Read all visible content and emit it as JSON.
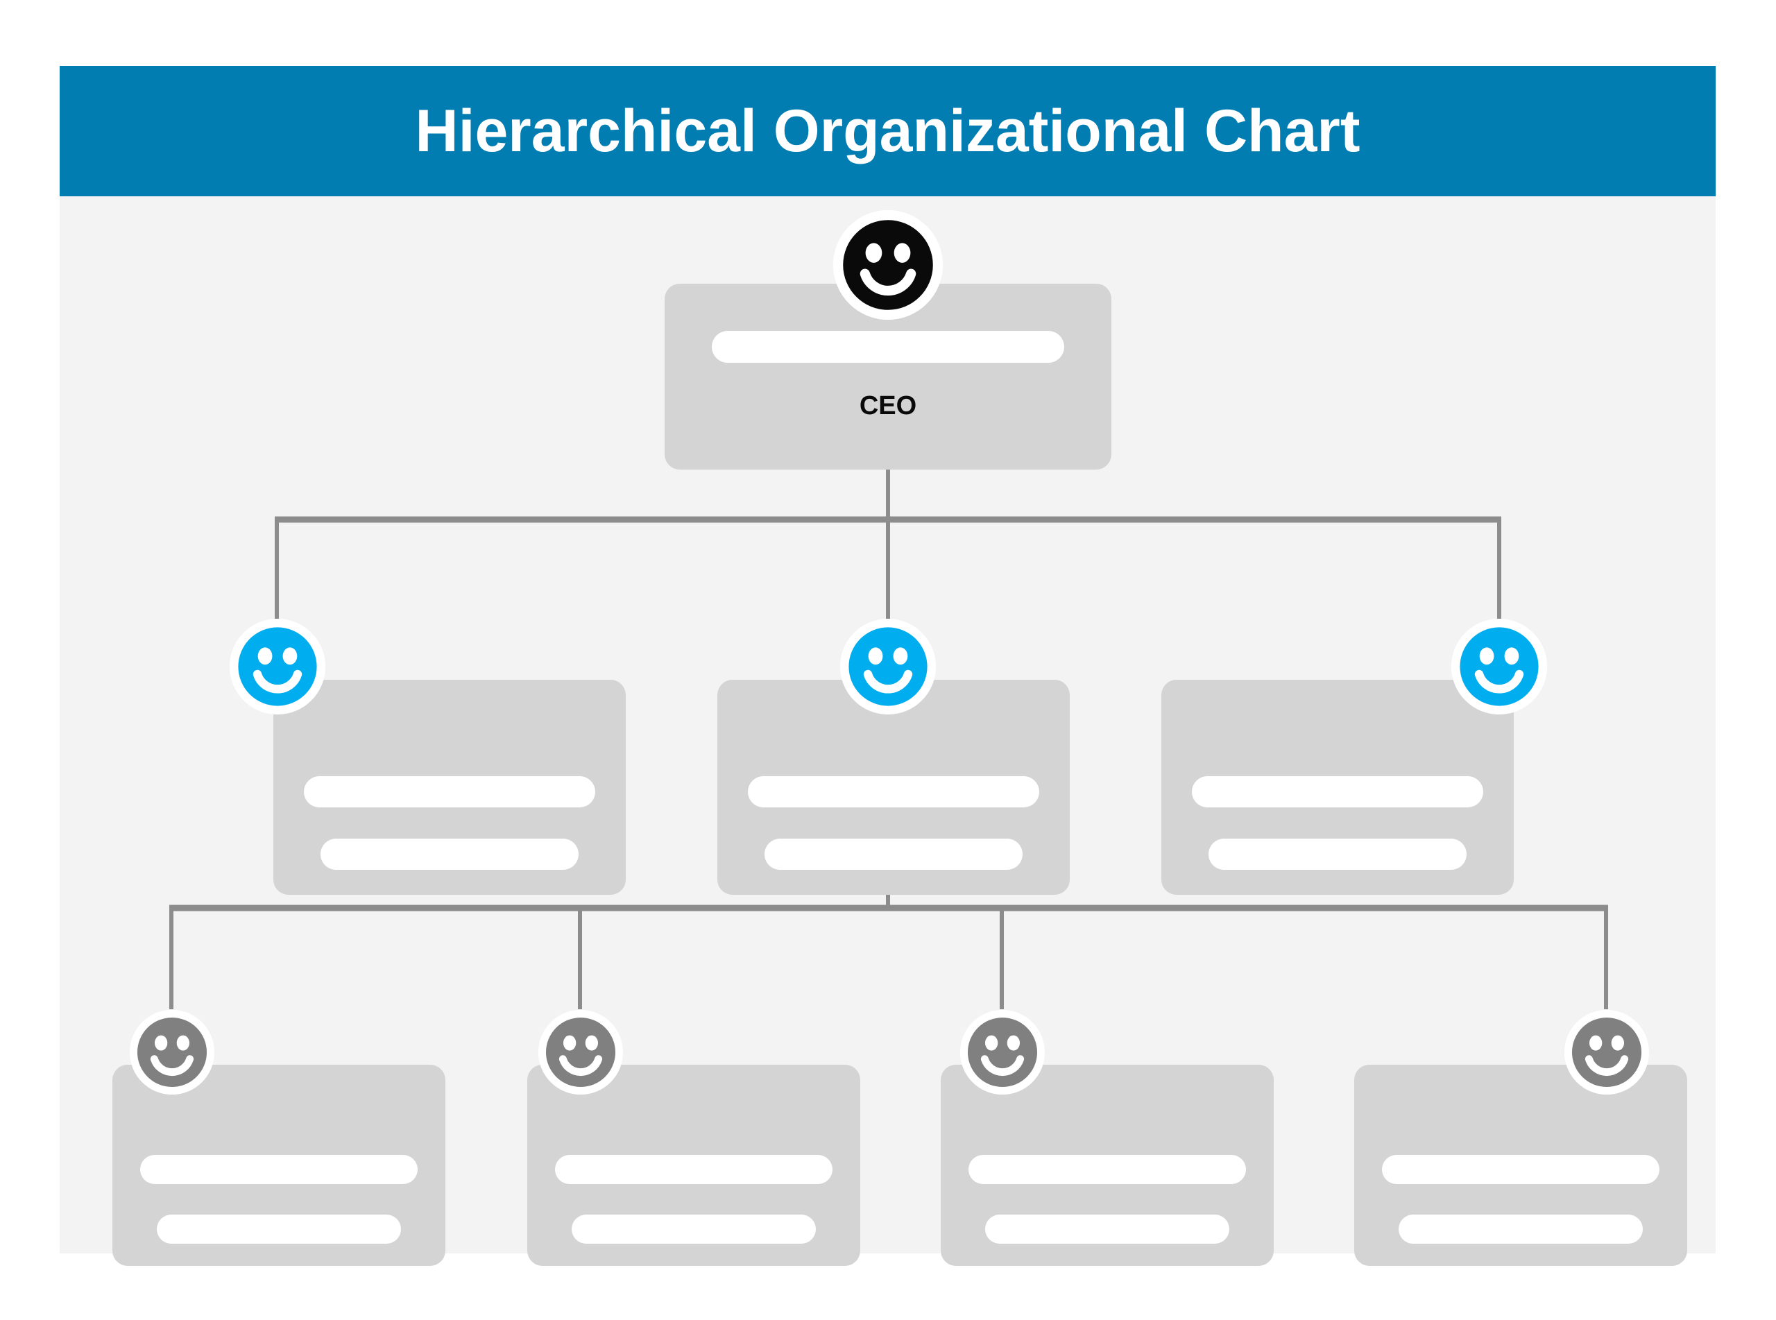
{
  "header": {
    "title": "Hierarchical Organizational Chart",
    "background_color": "#017DB1",
    "text_color": "#FFFFFF"
  },
  "panel": {
    "background_color": "#F3F3F3",
    "card_color": "#D4D4D4",
    "bar_color": "#FFFFFF",
    "connector_color": "#8C8C8C"
  },
  "chart_data": {
    "type": "diagram",
    "title": "Hierarchical Organizational Chart",
    "diagram_kind": "organizational-tree",
    "levels": 3,
    "nodes": [
      {
        "id": "ceo",
        "level": 1,
        "label": "CEO",
        "avatar_icon": "smiley-face-icon",
        "avatar_color": "#0A0A0A",
        "detail_bars": 1,
        "parent": null
      },
      {
        "id": "mgr-1",
        "level": 2,
        "label": "",
        "avatar_icon": "smiley-face-icon",
        "avatar_color": "#00ADEE",
        "detail_bars": 2,
        "parent": "ceo"
      },
      {
        "id": "mgr-2",
        "level": 2,
        "label": "",
        "avatar_icon": "smiley-face-icon",
        "avatar_color": "#00ADEE",
        "detail_bars": 2,
        "parent": "ceo"
      },
      {
        "id": "mgr-3",
        "level": 2,
        "label": "",
        "avatar_icon": "smiley-face-icon",
        "avatar_color": "#00ADEE",
        "detail_bars": 2,
        "parent": "ceo"
      },
      {
        "id": "staff-1",
        "level": 3,
        "label": "",
        "avatar_icon": "smiley-face-icon",
        "avatar_color": "#808080",
        "detail_bars": 2,
        "parent": "mgr-2"
      },
      {
        "id": "staff-2",
        "level": 3,
        "label": "",
        "avatar_icon": "smiley-face-icon",
        "avatar_color": "#808080",
        "detail_bars": 2,
        "parent": "mgr-2"
      },
      {
        "id": "staff-3",
        "level": 3,
        "label": "",
        "avatar_icon": "smiley-face-icon",
        "avatar_color": "#808080",
        "detail_bars": 2,
        "parent": "mgr-2"
      },
      {
        "id": "staff-4",
        "level": 3,
        "label": "",
        "avatar_icon": "smiley-face-icon",
        "avatar_color": "#808080",
        "detail_bars": 2,
        "parent": "mgr-2"
      }
    ],
    "edges": [
      {
        "from": "ceo",
        "to": "mgr-1"
      },
      {
        "from": "ceo",
        "to": "mgr-2"
      },
      {
        "from": "ceo",
        "to": "mgr-3"
      },
      {
        "from": "mgr-2",
        "to": "staff-1"
      },
      {
        "from": "mgr-2",
        "to": "staff-2"
      },
      {
        "from": "mgr-2",
        "to": "staff-3"
      },
      {
        "from": "mgr-2",
        "to": "staff-4"
      }
    ]
  }
}
